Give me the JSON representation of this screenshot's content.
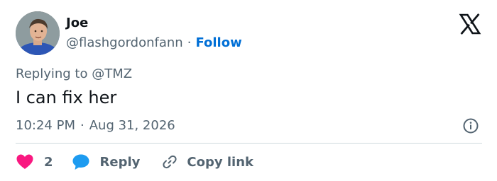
{
  "tweet": {
    "author_name": "Joe",
    "handle": "@flashgordonfann",
    "separator": "·",
    "follow_label": "Follow",
    "replying_prefix": "Replying to",
    "replying_to": "@TMZ",
    "text": "I can fix her",
    "time": "10:24 PM",
    "date_separator": "·",
    "date": "Aug 31, 2026"
  },
  "actions": {
    "like_count": "2",
    "reply_label": "Reply",
    "copy_link_label": "Copy link"
  },
  "icons": {
    "platform": "x-logo-icon",
    "info": "info-icon",
    "like": "heart-icon",
    "reply": "speech-bubble-icon",
    "copy": "link-icon"
  },
  "colors": {
    "text": "#0f1419",
    "secondary": "#536471",
    "follow": "#006fd6",
    "heart": "#f91880",
    "reply": "#1d9bf0",
    "divider": "#cfd9de"
  }
}
